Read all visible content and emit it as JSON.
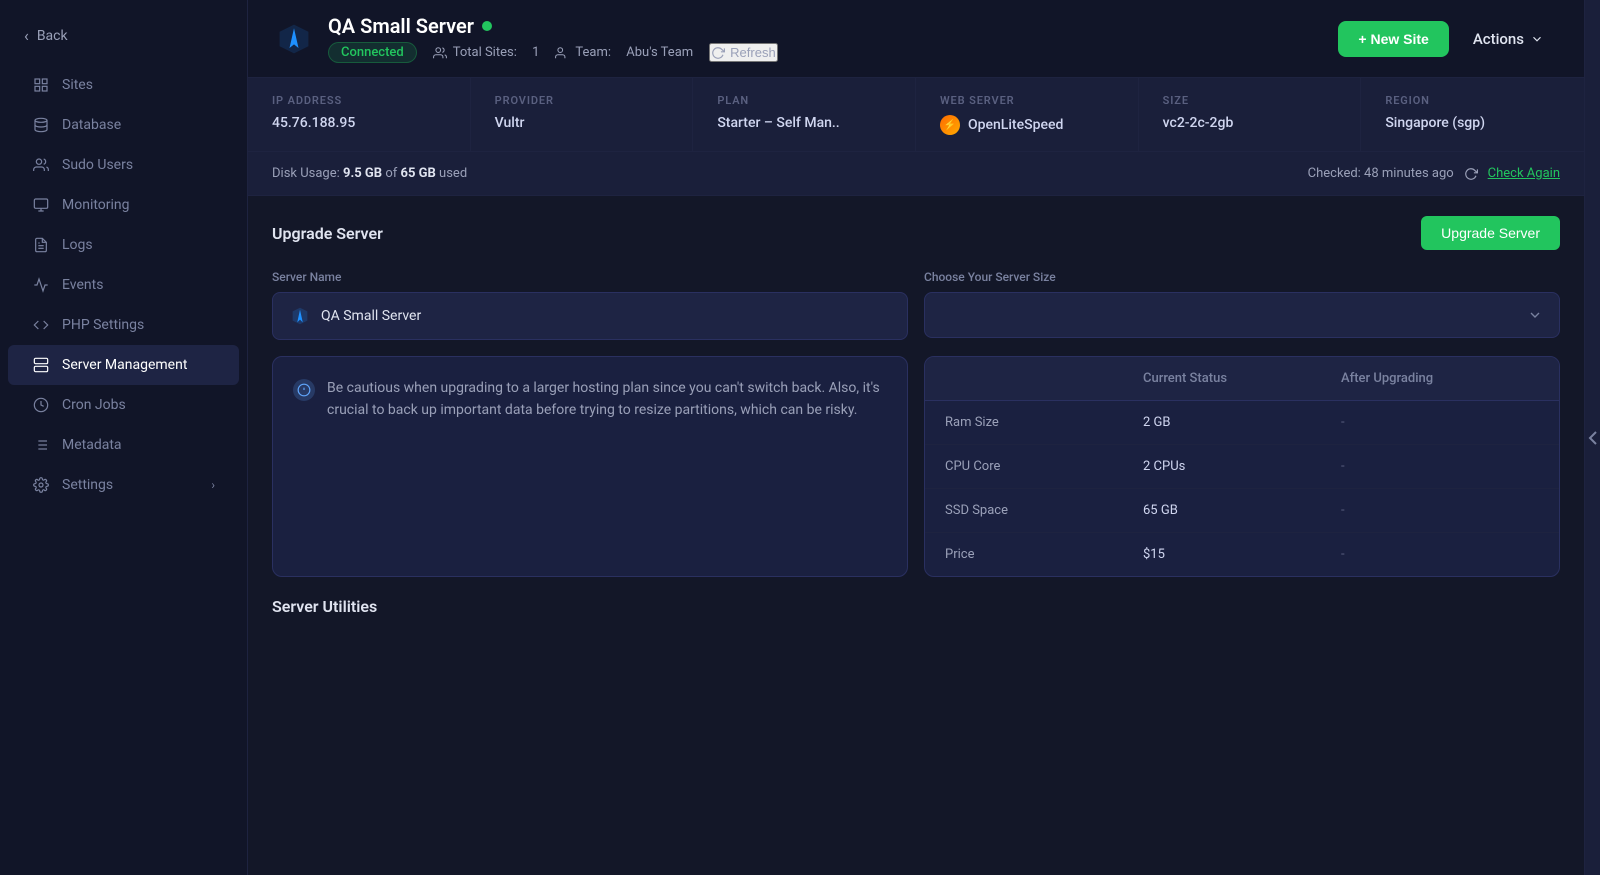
{
  "sidebar": {
    "back_label": "Back",
    "items": [
      {
        "id": "sites",
        "label": "Sites",
        "icon": "grid"
      },
      {
        "id": "database",
        "label": "Database",
        "icon": "database"
      },
      {
        "id": "sudo-users",
        "label": "Sudo Users",
        "icon": "users"
      },
      {
        "id": "monitoring",
        "label": "Monitoring",
        "icon": "monitor"
      },
      {
        "id": "logs",
        "label": "Logs",
        "icon": "file-text"
      },
      {
        "id": "events",
        "label": "Events",
        "icon": "activity"
      },
      {
        "id": "php-settings",
        "label": "PHP Settings",
        "icon": "code"
      },
      {
        "id": "server-management",
        "label": "Server Management",
        "icon": "server",
        "active": true
      },
      {
        "id": "cron-jobs",
        "label": "Cron Jobs",
        "icon": "clock"
      },
      {
        "id": "metadata",
        "label": "Metadata",
        "icon": "list"
      },
      {
        "id": "settings",
        "label": "Settings",
        "icon": "settings",
        "arrow": true
      }
    ]
  },
  "header": {
    "server_name": "QA Small Server",
    "status": "Connected",
    "total_sites_label": "Total Sites:",
    "total_sites_value": "1",
    "team_label": "Team:",
    "team_value": "Abu's Team",
    "refresh_label": "Refresh",
    "new_site_label": "+ New Site",
    "actions_label": "Actions"
  },
  "info_bar": {
    "ip_address_label": "IP ADDRESS",
    "ip_address_value": "45.76.188.95",
    "provider_label": "PROVIDER",
    "provider_value": "Vultr",
    "plan_label": "PLAN",
    "plan_value": "Starter – Self Man..",
    "web_server_label": "WEB SERVER",
    "web_server_value": "OpenLiteSpeed",
    "size_label": "SIZE",
    "size_value": "vc2-2c-2gb",
    "region_label": "REGION",
    "region_value": "Singapore (sgp)"
  },
  "disk_usage": {
    "label": "Disk Usage:",
    "used": "9.5 GB",
    "of_label": "of",
    "total": "65 GB",
    "used_suffix": "used",
    "checked_label": "Checked: 48 minutes ago",
    "check_again": "Check Again"
  },
  "upgrade_server": {
    "section_title": "Upgrade Server",
    "btn_label": "Upgrade Server",
    "server_name_label": "Server Name",
    "server_name_value": "QA Small Server",
    "choose_size_label": "Choose Your Server Size",
    "choose_size_placeholder": "",
    "warning_text": "Be cautious when upgrading to a larger hosting plan since you can't switch back. Also, it's crucial to back up important data before trying to resize partitions, which can be risky.",
    "comparison": {
      "current_status_label": "Current Status",
      "after_upgrading_label": "After Upgrading",
      "rows": [
        {
          "label": "Ram Size",
          "current": "2 GB",
          "after": "-"
        },
        {
          "label": "CPU Core",
          "current": "2 CPUs",
          "after": "-"
        },
        {
          "label": "SSD Space",
          "current": "65 GB",
          "after": "-"
        },
        {
          "label": "Price",
          "current": "$15",
          "after": "-"
        }
      ]
    }
  },
  "server_utilities": {
    "section_title": "Server Utilities"
  }
}
